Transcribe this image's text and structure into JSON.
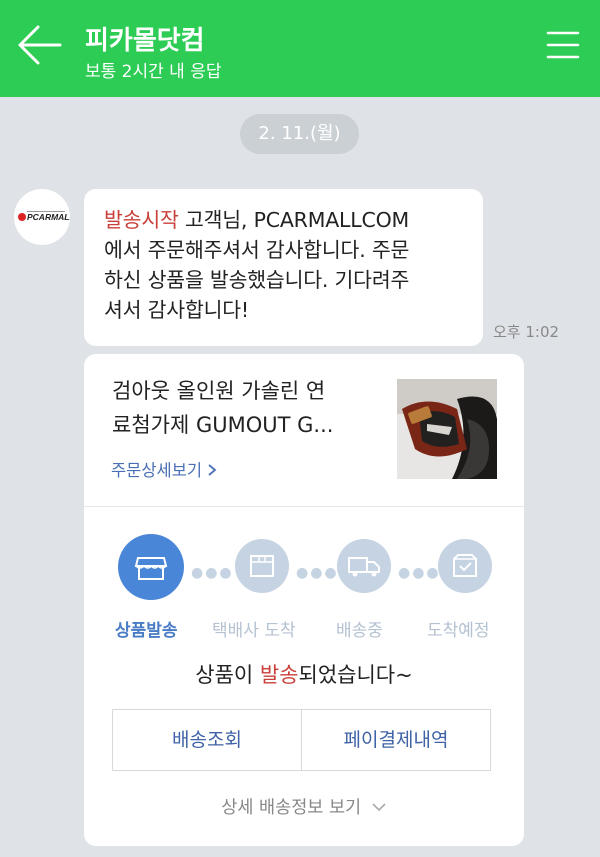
{
  "header": {
    "title": "피카몰닷컴",
    "subtitle": "보통 2시간 내 응답"
  },
  "chat": {
    "date": "2. 11.(월)",
    "avatar_logo_text": "PCARMALL",
    "message": {
      "highlight": "발송시작",
      "line1_rest": " 고객님, PCARMALLCOM",
      "line2": "에서 주문해주셔서 감사합니다. 주문",
      "line3": "하신 상품을 발송했습니다. 기다려주",
      "line4": "셔서 감사합니다!"
    },
    "time": "오후 1:02"
  },
  "card": {
    "product_line1": "검아웃 올인원 가솔린 연",
    "product_line2": "료첨가제 GUMOUT G...",
    "order_detail_link": "주문상세보기",
    "steps": [
      {
        "label": "상품발송",
        "icon": "store-icon",
        "active": true
      },
      {
        "label": "택배사 도착",
        "icon": "box-icon",
        "active": false
      },
      {
        "label": "배송중",
        "icon": "truck-icon",
        "active": false
      },
      {
        "label": "도착예정",
        "icon": "inbox-check-icon",
        "active": false
      }
    ],
    "status_prefix": "상품이 ",
    "status_highlight": "발송",
    "status_suffix": "되었습니다~",
    "track_button": "배송조회",
    "payment_button": "페이결제내역",
    "shipping_detail_link": "상세 배송정보 보기"
  },
  "colors": {
    "header_green": "#2dcc55",
    "accent_blue": "#4a86d8",
    "highlight_red": "#c9403a"
  }
}
